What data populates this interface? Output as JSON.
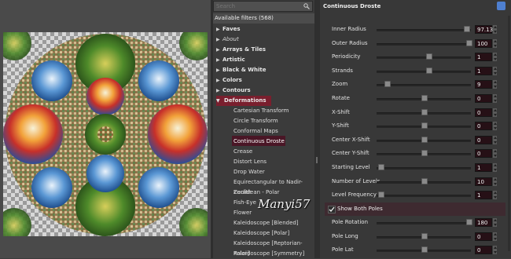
{
  "search": {
    "placeholder": "Search"
  },
  "filters": {
    "available_label": "Available filters (568)",
    "categories": [
      {
        "label": "Faves",
        "italic": false
      },
      {
        "label": "About",
        "italic": true
      },
      {
        "label": "Arrays & Tiles",
        "italic": false
      },
      {
        "label": "Artistic",
        "italic": false
      },
      {
        "label": "Black & White",
        "italic": false
      },
      {
        "label": "Colors",
        "italic": false
      },
      {
        "label": "Contours",
        "italic": false
      }
    ],
    "selected_category": "Deformations",
    "items": [
      "Cartesian Transform",
      "Circle Transform",
      "Conformal Maps",
      "Continuous Droste",
      "Crease",
      "Distort Lens",
      "Drop Water",
      "Equirectangular to Nadir-Zenith",
      "Euclidean - Polar",
      "Fish-Eye",
      "Flower",
      "Kaleidoscope [Blended]",
      "Kaleidoscope [Polar]",
      "Kaleidoscope [Reptorian-Polar]",
      "Kaleidoscope [Symmetry]"
    ]
  },
  "params": {
    "title": "Continuous Droste",
    "sliders": [
      {
        "label": "Inner Radius",
        "value": "97.13",
        "fraction": 0.97
      },
      {
        "label": "Outer Radius",
        "value": "100",
        "fraction": 1.0
      },
      {
        "label": "Periodicity",
        "value": "1",
        "fraction": 0.55
      },
      {
        "label": "Strands",
        "value": "1",
        "fraction": 0.55
      },
      {
        "label": "Zoom",
        "value": "9",
        "fraction": 0.09
      },
      {
        "label": "Rotate",
        "value": "0",
        "fraction": 0.5
      },
      {
        "label": "X-Shift",
        "value": "0",
        "fraction": 0.5
      },
      {
        "label": "Y-Shift",
        "value": "0",
        "fraction": 0.5
      },
      {
        "label": "Center X-Shift",
        "value": "0",
        "fraction": 0.5
      },
      {
        "label": "Center Y-Shift",
        "value": "0",
        "fraction": 0.5
      },
      {
        "label": "Starting Level",
        "value": "1",
        "fraction": 0.02
      },
      {
        "label": "Number of Levels",
        "value": "10",
        "fraction": 0.5
      },
      {
        "label": "Level Frequency",
        "value": "1",
        "fraction": 0.02
      }
    ],
    "show_both_poles": {
      "label": "Show Both Poles",
      "checked": true
    },
    "sliders2": [
      {
        "label": "Pole Rotation",
        "value": "180",
        "fraction": 1.0
      },
      {
        "label": "Pole Long",
        "value": "0",
        "fraction": 0.5
      },
      {
        "label": "Pole Lat",
        "value": "0",
        "fraction": 0.5
      }
    ]
  },
  "watermark": "Manyi57"
}
